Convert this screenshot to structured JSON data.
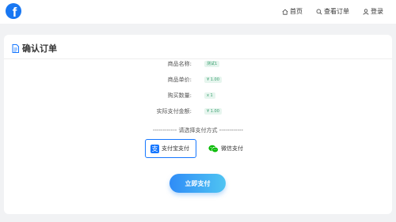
{
  "header": {
    "logo_letter": "f",
    "nav": {
      "home_label": "首页",
      "query_label": "查看订单",
      "login_label": "登录"
    }
  },
  "card": {
    "title": "确认订单",
    "rows": [
      {
        "label": "商品名称:",
        "value": "测试1"
      },
      {
        "label": "商品单价:",
        "value": "¥ 1.00"
      },
      {
        "label": "购买数量:",
        "value": "x 1"
      },
      {
        "label": "实际支付金额:",
        "value": "¥ 1.00"
      }
    ],
    "payment_divider": "------------ 请选择支付方式 ------------",
    "payment_methods": {
      "alipay_label": "支付宝支付",
      "alipay_icon_glyph": "支",
      "wechat_label": "微信支付"
    },
    "submit_label": "立即支付"
  },
  "colors": {
    "brand": "#1877f2",
    "accent": "#1677ff",
    "wechat": "#09bb07",
    "value_tag_bg": "#e6f5ee",
    "value_tag_text": "#3a9f6f"
  },
  "icons": [
    "facebook-logo",
    "home-icon",
    "search-icon",
    "user-icon",
    "document-icon",
    "alipay-icon",
    "wechat-icon"
  ]
}
